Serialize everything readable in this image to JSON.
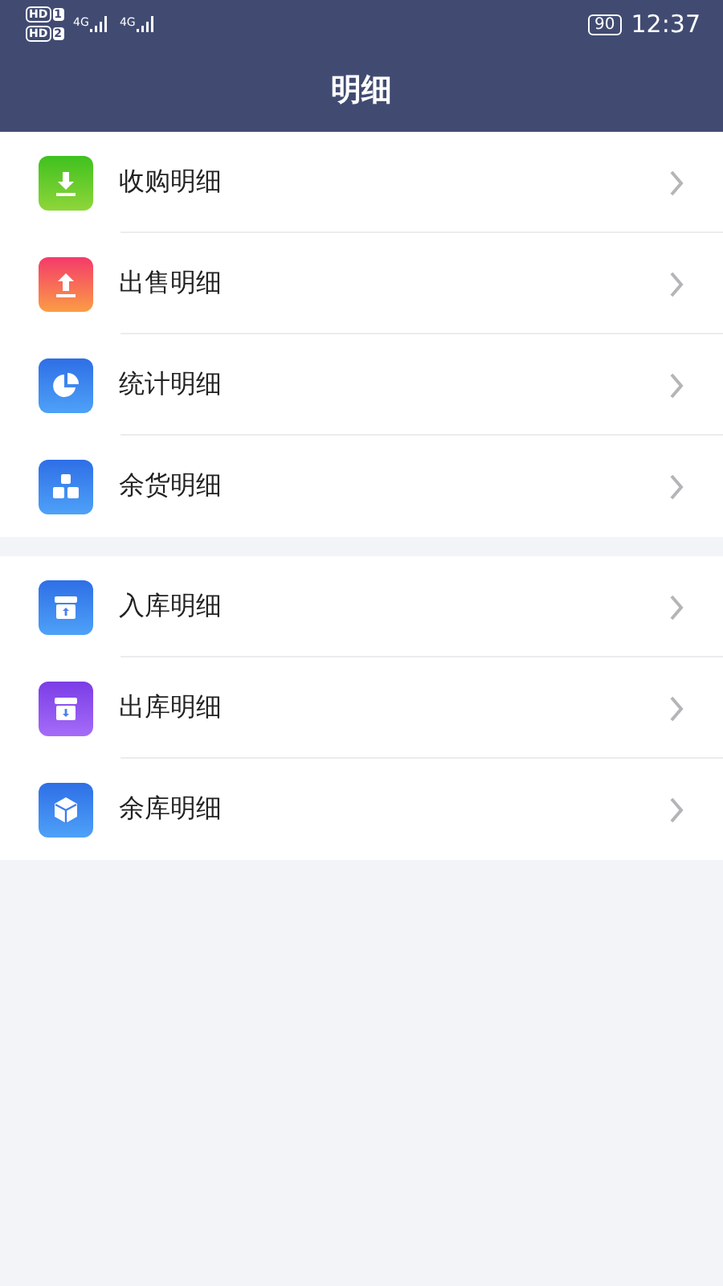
{
  "status_bar": {
    "sims": [
      {
        "badge": "HD",
        "slot": "1"
      },
      {
        "badge": "HD",
        "slot": "2"
      }
    ],
    "networks": [
      "4G",
      "4G"
    ],
    "battery": "90",
    "time": "12:37"
  },
  "header": {
    "title": "明细"
  },
  "groups": [
    {
      "items": [
        {
          "label": "收购明细",
          "kind": "download"
        },
        {
          "label": "出售明细",
          "kind": "upload"
        },
        {
          "label": "统计明细",
          "kind": "pie"
        },
        {
          "label": "余货明细",
          "kind": "stack"
        }
      ]
    },
    {
      "items": [
        {
          "label": "入库明细",
          "kind": "box-in"
        },
        {
          "label": "出库明细",
          "kind": "box-out"
        },
        {
          "label": "余库明细",
          "kind": "cube"
        }
      ]
    }
  ]
}
